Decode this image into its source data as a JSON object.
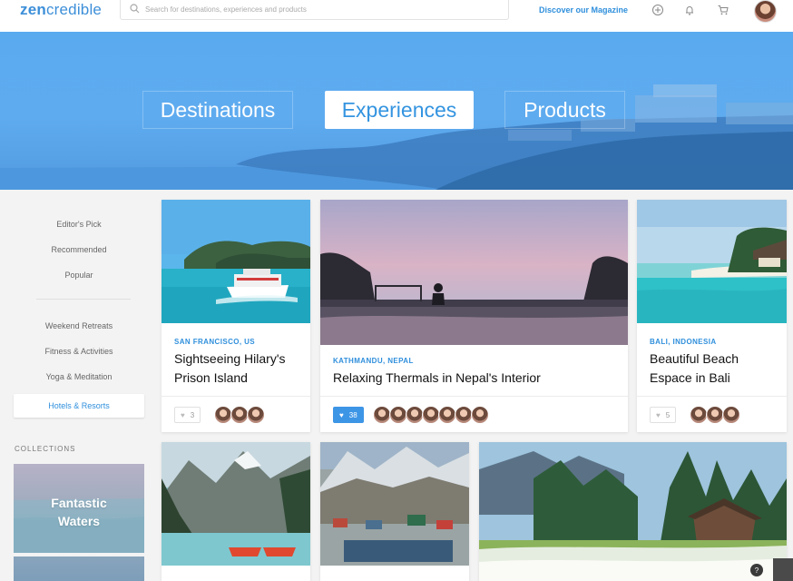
{
  "header": {
    "logo_part1": "zen",
    "logo_part2": "credible",
    "search_placeholder": "Search for destinations, experiences and products",
    "magazine_link": "Discover our Magazine",
    "icons": [
      "search-icon",
      "plus-circle-icon",
      "bell-icon",
      "cart-icon",
      "avatar"
    ]
  },
  "hero": {
    "tabs": [
      {
        "label": "Destinations",
        "active": false
      },
      {
        "label": "Experiences",
        "active": true
      },
      {
        "label": "Products",
        "active": false
      }
    ]
  },
  "sidebar": {
    "group1": [
      "Editor's Pick",
      "Recommended",
      "Popular"
    ],
    "group2": [
      "Weekend Retreats",
      "Fitness & Activities",
      "Yoga & Meditation"
    ],
    "active": "Hotels & Resorts",
    "collections_title": "COLLECTIONS",
    "collections": [
      {
        "title_line1": "Fantastic",
        "title_line2": "Waters"
      }
    ]
  },
  "cards": [
    {
      "location": "SAN FRANCISCO, US",
      "title_line1": "Sightseeing Hilary's",
      "title_line2": "Prison Island",
      "likes": "3",
      "liked": false,
      "avatars": 3
    },
    {
      "location": "KATHMANDU, NEPAL",
      "title_line1": "Relaxing Thermals in Nepal's Interior",
      "likes": "38",
      "liked": true,
      "avatars": 7
    },
    {
      "location": "BALI, INDONESIA",
      "title_line1": "Beautiful Beach",
      "title_line2": "Espace in Bali",
      "likes": "5",
      "liked": false,
      "avatars": 3
    }
  ],
  "colors": {
    "accent": "#2f8fdc",
    "like_active": "#3d95e6",
    "hero_sky": "#5aaaf0"
  },
  "help_label": "?"
}
